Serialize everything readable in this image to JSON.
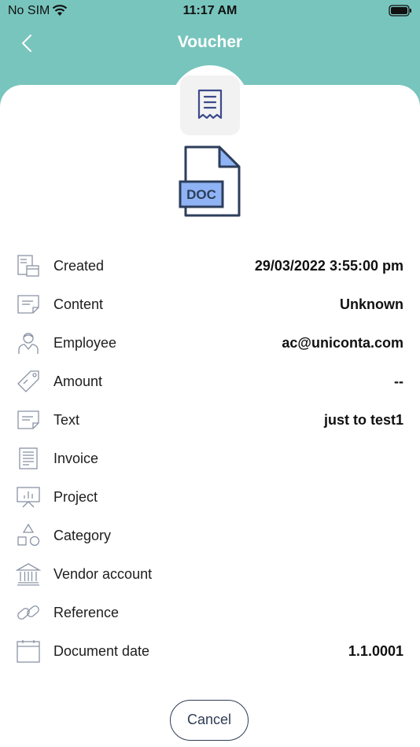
{
  "status_bar": {
    "carrier": "No SIM",
    "time": "11:17 AM"
  },
  "header": {
    "title": "Voucher",
    "back_icon": "chevron-left-icon"
  },
  "colors": {
    "header_bg": "#78c5bd",
    "doc_fill": "#8fb3f5",
    "icon_stroke": "#2c3e5a"
  },
  "file": {
    "type_label": "DOC",
    "voucher_icon": "receipt-icon"
  },
  "fields": [
    {
      "label": "Created",
      "value": "29/03/2022 3:55:00 pm",
      "icon": "calendar-document-icon"
    },
    {
      "label": "Content",
      "value": "Unknown",
      "icon": "note-icon"
    },
    {
      "label": "Employee",
      "value": "ac@uniconta.com",
      "icon": "person-icon"
    },
    {
      "label": "Amount",
      "value": "--",
      "icon": "price-tag-icon"
    },
    {
      "label": "Text",
      "value": "just to test1",
      "icon": "note-icon"
    },
    {
      "label": "Invoice",
      "value": "",
      "icon": "invoice-icon"
    },
    {
      "label": "Project",
      "value": "",
      "icon": "presentation-icon"
    },
    {
      "label": "Category",
      "value": "",
      "icon": "shapes-icon"
    },
    {
      "label": "Vendor account",
      "value": "",
      "icon": "bank-icon"
    },
    {
      "label": "Reference",
      "value": "",
      "icon": "link-icon"
    },
    {
      "label": "Document date",
      "value": "1.1.0001",
      "icon": "calendar-icon"
    }
  ],
  "actions": {
    "cancel_label": "Cancel"
  }
}
